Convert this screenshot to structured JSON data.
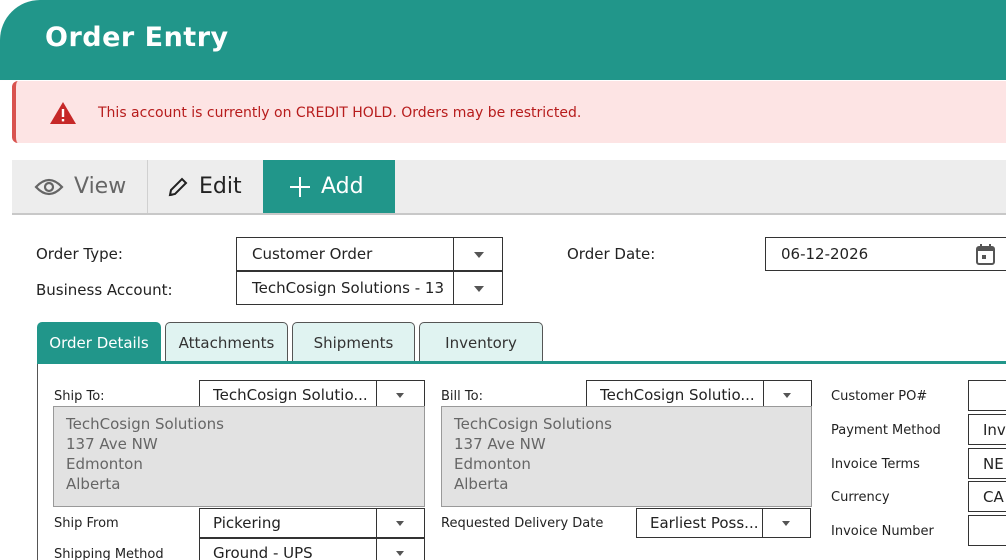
{
  "header": {
    "title": "Order Entry"
  },
  "alert": {
    "message": "This account is currently on CREDIT HOLD. Orders may be restricted."
  },
  "toolbar": {
    "view_label": "View",
    "edit_label": "Edit",
    "add_label": "Add"
  },
  "form": {
    "order_type_label": "Order Type:",
    "order_type_value": "Customer Order",
    "business_account_label": "Business Account:",
    "business_account_value": "TechCosign Solutions - 13",
    "order_date_label": "Order Date:",
    "order_date_value": "06-12-2026"
  },
  "tabs": [
    {
      "label": "Order Details",
      "active": true
    },
    {
      "label": "Attachments",
      "active": false
    },
    {
      "label": "Shipments",
      "active": false
    },
    {
      "label": "Inventory",
      "active": false
    }
  ],
  "details": {
    "ship_to_label": "Ship To:",
    "ship_to_value": "TechCosign Solutio...",
    "ship_to_address": [
      "TechCosign Solutions",
      "137 Ave NW",
      "Edmonton",
      "Alberta"
    ],
    "bill_to_label": "Bill To:",
    "bill_to_value": "TechCosign Solutio...",
    "bill_to_address": [
      "TechCosign Solutions",
      "137 Ave NW",
      "Edmonton",
      "Alberta"
    ],
    "ship_from_label": "Ship From",
    "ship_from_value": "Pickering",
    "shipping_method_label": "Shipping Method",
    "shipping_method_value": "Ground - UPS",
    "requested_delivery_label": "Requested Delivery Date",
    "requested_delivery_value": "Earliest Poss...",
    "customer_po_label": "Customer PO#",
    "customer_po_value": "",
    "payment_method_label": "Payment Method",
    "payment_method_value": "Inv",
    "invoice_terms_label": "Invoice Terms",
    "invoice_terms_value": "NE",
    "currency_label": "Currency",
    "currency_value": "CA",
    "invoice_number_label": "Invoice Number",
    "invoice_number_value": ""
  },
  "colors": {
    "accent": "#21968a",
    "alert_bg": "#fde4e4",
    "alert_text": "#b71c1c"
  },
  "icons": {
    "alert": "warning-triangle-icon",
    "view": "eye-icon",
    "edit": "pencil-icon",
    "add": "plus-icon",
    "date": "calendar-icon"
  }
}
